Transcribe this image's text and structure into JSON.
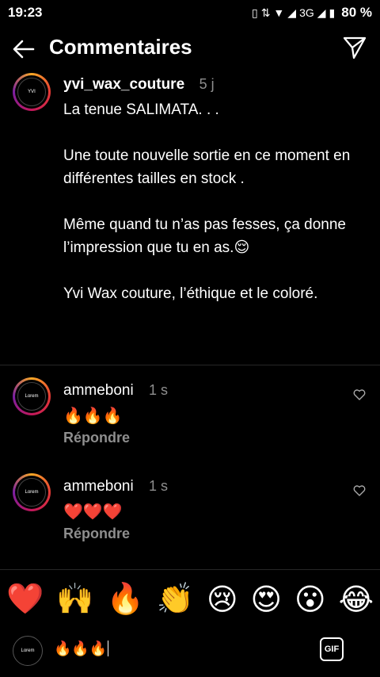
{
  "status": {
    "time": "19:23",
    "battery": "80 %",
    "network": "3G"
  },
  "header": {
    "title": "Commentaires"
  },
  "caption": {
    "username": "yvi_wax_couture",
    "age": "5 j",
    "text": "La tenue SALIMATA. . .\n\nUne toute nouvelle sortie en ce moment en différentes tailles en stock .\n\nMême quand tu n’as pas fesses, ça donne l’impression que tu en as.😌\n\nYvi Wax couture, l’éthique et le coloré."
  },
  "comments": [
    {
      "username": "ammeboni",
      "age": "1 s",
      "text": "🔥🔥🔥",
      "reply": "Répondre"
    },
    {
      "username": "ammeboni",
      "age": "1 s",
      "text": "❤️❤️❤️",
      "reply": "Répondre"
    }
  ],
  "emoji_bar": [
    "❤️",
    "🙌",
    "🔥",
    "👏",
    "😢",
    "😍",
    "😮",
    "😂"
  ],
  "input": {
    "value": "🔥🔥🔥",
    "gif_label": "GIF"
  },
  "avatar_text": {
    "yvi": "YVI",
    "amme": "Lorem"
  }
}
